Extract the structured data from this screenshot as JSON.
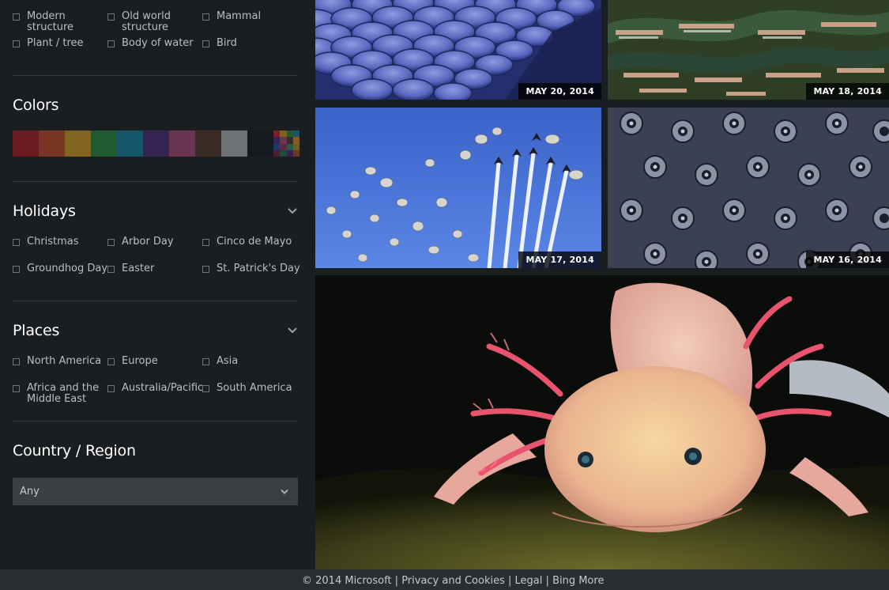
{
  "categories": {
    "items": [
      {
        "label": "Modern structure"
      },
      {
        "label": "Old world structure"
      },
      {
        "label": "Mammal"
      },
      {
        "label": "Plant / tree"
      },
      {
        "label": "Body of water"
      },
      {
        "label": "Bird"
      }
    ]
  },
  "colors": {
    "title": "Colors",
    "swatches": [
      "#6b1a1f",
      "#7a3624",
      "#806420",
      "#1f5a30",
      "#17566a",
      "#352552",
      "#6a3552",
      "#3b2d26",
      "#6d7277",
      "#161a1e",
      "multi"
    ]
  },
  "holidays": {
    "title": "Holidays",
    "items": [
      {
        "label": "Christmas"
      },
      {
        "label": "Arbor Day"
      },
      {
        "label": "Cinco de Mayo"
      },
      {
        "label": "Groundhog Day"
      },
      {
        "label": "Easter"
      },
      {
        "label": "St. Patrick's Day"
      }
    ]
  },
  "places": {
    "title": "Places",
    "items": [
      {
        "label": "North America"
      },
      {
        "label": "Europe"
      },
      {
        "label": "Asia"
      },
      {
        "label": "Africa and the Middle East"
      },
      {
        "label": "Australia/Pacific"
      },
      {
        "label": "South America"
      }
    ]
  },
  "country": {
    "title": "Country / Region",
    "selected": "Any"
  },
  "images": [
    {
      "date": "MAY 20, 2014"
    },
    {
      "date": "MAY 18, 2014"
    },
    {
      "date": "MAY 17, 2014"
    },
    {
      "date": "MAY 16, 2014"
    }
  ],
  "footer": {
    "copyright": "© 2014 Microsoft",
    "privacy": "Privacy and Cookies",
    "legal": "Legal",
    "more": "Bing More",
    "separator": "|"
  }
}
